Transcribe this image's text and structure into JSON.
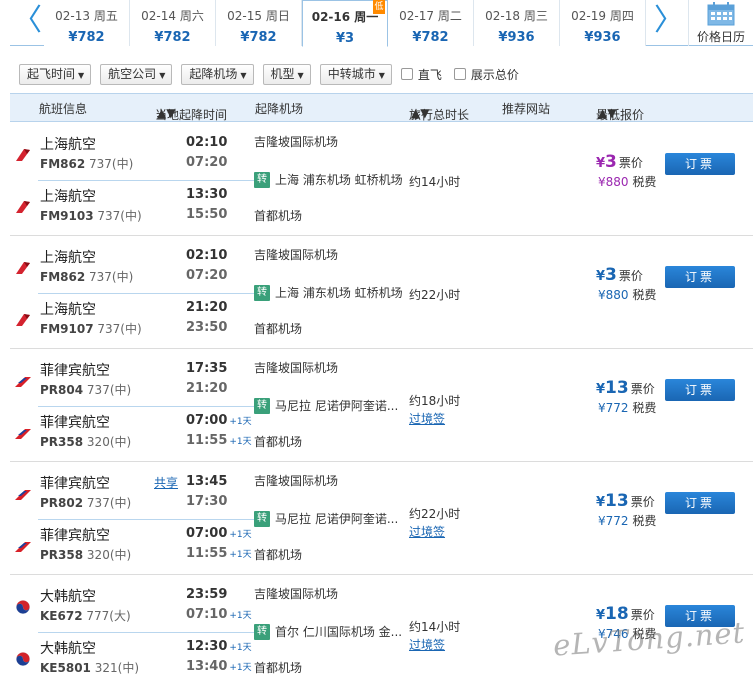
{
  "date_strip": {
    "prev_arrow": "〈",
    "next_arrow": "〉",
    "dates": [
      {
        "date": "02-13 周五",
        "price": "¥782"
      },
      {
        "date": "02-14 周六",
        "price": "¥782"
      },
      {
        "date": "02-15 周日",
        "price": "¥782"
      },
      {
        "date": "02-16 周一",
        "price": "¥3",
        "badge": "低"
      },
      {
        "date": "02-17 周二",
        "price": "¥782"
      },
      {
        "date": "02-18 周三",
        "price": "¥936"
      },
      {
        "date": "02-19 周四",
        "price": "¥936"
      }
    ],
    "calendar_label": "价格日历"
  },
  "filters": {
    "dropdowns": [
      "起飞时间",
      "航空公司",
      "起降机场",
      "机型",
      "中转城市"
    ],
    "checkboxes": [
      "直飞",
      "展示总价"
    ]
  },
  "header": {
    "flight_info": "航班信息",
    "times": "当地起降时间",
    "airports": "起降机场",
    "duration": "旅行总时长",
    "site": "推荐网站",
    "price": "最低报价"
  },
  "colors": {
    "purple_price": "#9b27b0",
    "blue_price": "#1a66b3",
    "badge_orange": "#ff8a00",
    "transfer_green": "#3aa07a"
  },
  "flights": [
    {
      "legs": [
        {
          "airline": "上海航空",
          "flight": "FM862",
          "plane": "737(中)",
          "dep": "02:10",
          "arr": "07:20",
          "dep_plus": "",
          "arr_plus": "",
          "logo": "shanghai-airlines"
        },
        {
          "airline": "上海航空",
          "flight": "FM9103",
          "plane": "737(中)",
          "dep": "13:30",
          "arr": "15:50",
          "dep_plus": "",
          "arr_plus": "",
          "logo": "shanghai-airlines"
        }
      ],
      "share": "",
      "dep_airport": "吉隆坡国际机场",
      "transfer_badge": "转",
      "transfer": "上海 浦东机场 虹桥机场",
      "arr_airport": "首都机场",
      "duration": "约14小时",
      "visa": "",
      "price_yen": "¥",
      "price": "3",
      "price_label": "票价",
      "tax": "¥880",
      "tax_label": "税费",
      "price_color": "purple",
      "book": "订票"
    },
    {
      "legs": [
        {
          "airline": "上海航空",
          "flight": "FM862",
          "plane": "737(中)",
          "dep": "02:10",
          "arr": "07:20",
          "dep_plus": "",
          "arr_plus": "",
          "logo": "shanghai-airlines"
        },
        {
          "airline": "上海航空",
          "flight": "FM9107",
          "plane": "737(中)",
          "dep": "21:20",
          "arr": "23:50",
          "dep_plus": "",
          "arr_plus": "",
          "logo": "shanghai-airlines"
        }
      ],
      "share": "",
      "dep_airport": "吉隆坡国际机场",
      "transfer_badge": "转",
      "transfer": "上海 浦东机场 虹桥机场",
      "arr_airport": "首都机场",
      "duration": "约22小时",
      "visa": "",
      "price_yen": "¥",
      "price": "3",
      "price_label": "票价",
      "tax": "¥880",
      "tax_label": "税费",
      "price_color": "blue",
      "book": "订票"
    },
    {
      "legs": [
        {
          "airline": "菲律宾航空",
          "flight": "PR804",
          "plane": "737(中)",
          "dep": "17:35",
          "arr": "21:20",
          "dep_plus": "",
          "arr_plus": "",
          "logo": "philippine-airlines"
        },
        {
          "airline": "菲律宾航空",
          "flight": "PR358",
          "plane": "320(中)",
          "dep": "07:00",
          "arr": "11:55",
          "dep_plus": "+1天",
          "arr_plus": "+1天",
          "logo": "philippine-airlines"
        }
      ],
      "share": "",
      "dep_airport": "吉隆坡国际机场",
      "transfer_badge": "转",
      "transfer": "马尼拉 尼诺伊阿奎诺...",
      "arr_airport": "首都机场",
      "duration": "约18小时",
      "visa": "过境签",
      "price_yen": "¥",
      "price": "13",
      "price_label": "票价",
      "tax": "¥772",
      "tax_label": "税费",
      "price_color": "blue",
      "book": "订票"
    },
    {
      "legs": [
        {
          "airline": "菲律宾航空",
          "flight": "PR802",
          "plane": "737(中)",
          "dep": "13:45",
          "arr": "17:30",
          "dep_plus": "",
          "arr_plus": "",
          "logo": "philippine-airlines"
        },
        {
          "airline": "菲律宾航空",
          "flight": "PR358",
          "plane": "320(中)",
          "dep": "07:00",
          "arr": "11:55",
          "dep_plus": "+1天",
          "arr_plus": "+1天",
          "logo": "philippine-airlines"
        }
      ],
      "share": "共享",
      "dep_airport": "吉隆坡国际机场",
      "transfer_badge": "转",
      "transfer": "马尼拉 尼诺伊阿奎诺...",
      "arr_airport": "首都机场",
      "duration": "约22小时",
      "visa": "过境签",
      "price_yen": "¥",
      "price": "13",
      "price_label": "票价",
      "tax": "¥772",
      "tax_label": "税费",
      "price_color": "blue",
      "book": "订票"
    },
    {
      "legs": [
        {
          "airline": "大韩航空",
          "flight": "KE672",
          "plane": "777(大)",
          "dep": "23:59",
          "arr": "07:10",
          "dep_plus": "",
          "arr_plus": "+1天",
          "logo": "korean-air"
        },
        {
          "airline": "大韩航空",
          "flight": "KE5801",
          "plane": "321(中)",
          "dep": "12:30",
          "arr": "13:40",
          "dep_plus": "+1天",
          "arr_plus": "+1天",
          "logo": "korean-air"
        }
      ],
      "share": "",
      "dep_airport": "吉隆坡国际机场",
      "transfer_badge": "转",
      "transfer": "首尔 仁川国际机场 金...",
      "arr_airport": "首都机场",
      "duration": "约14小时",
      "visa": "过境签",
      "price_yen": "¥",
      "price": "18",
      "price_label": "票价",
      "tax": "¥746",
      "tax_label": "税费",
      "price_color": "blue",
      "book": "订票"
    }
  ],
  "watermark": "eLvTong.net"
}
